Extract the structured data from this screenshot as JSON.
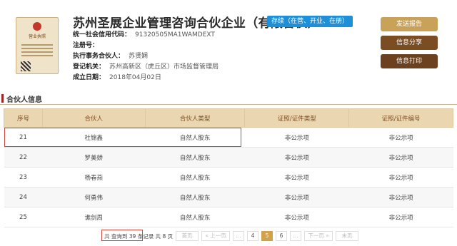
{
  "company": {
    "name": "苏州圣展企业管理咨询合伙企业（有限合伙）",
    "status": "存续（在营、开业、在册）",
    "license_title": "营业执照",
    "fields": [
      {
        "label": "统一社会信用代码：",
        "value": "91320505MA1WAMDEXT"
      },
      {
        "label": "注册号：",
        "value": ""
      },
      {
        "label": "执行事务合伙人：",
        "value": "苏贤娴"
      },
      {
        "label": "登记机关：",
        "value": "苏州高新区（虎丘区）市场监督管理局"
      },
      {
        "label": "成立日期：",
        "value": "2018年04月02日"
      }
    ]
  },
  "actions": {
    "send_report": "发送报告",
    "share": "信息分享",
    "print": "信息打印"
  },
  "section": {
    "title": "合伙人信息"
  },
  "table": {
    "headers": [
      "序号",
      "合伙人",
      "合伙人类型",
      "证照/证件类型",
      "证照/证件编号"
    ],
    "rows": [
      [
        "21",
        "杜锦鑫",
        "自然人股东",
        "非公示项",
        "非公示项"
      ],
      [
        "22",
        "罗美娇",
        "自然人股东",
        "非公示项",
        "非公示项"
      ],
      [
        "23",
        "杨春燕",
        "自然人股东",
        "非公示项",
        "非公示项"
      ],
      [
        "24",
        "何勇伟",
        "自然人股东",
        "非公示项",
        "非公示项"
      ],
      [
        "25",
        "谯剑周",
        "自然人股东",
        "非公示项",
        "非公示项"
      ]
    ]
  },
  "pagination": {
    "summary": "共 查询到 39 条记录 共 8 页",
    "first": "首页",
    "prev": "« 上一页",
    "ellipsis": "...",
    "pages": [
      "4",
      "5",
      "6"
    ],
    "current": "5",
    "next": "下一页 »",
    "last": "末页"
  }
}
